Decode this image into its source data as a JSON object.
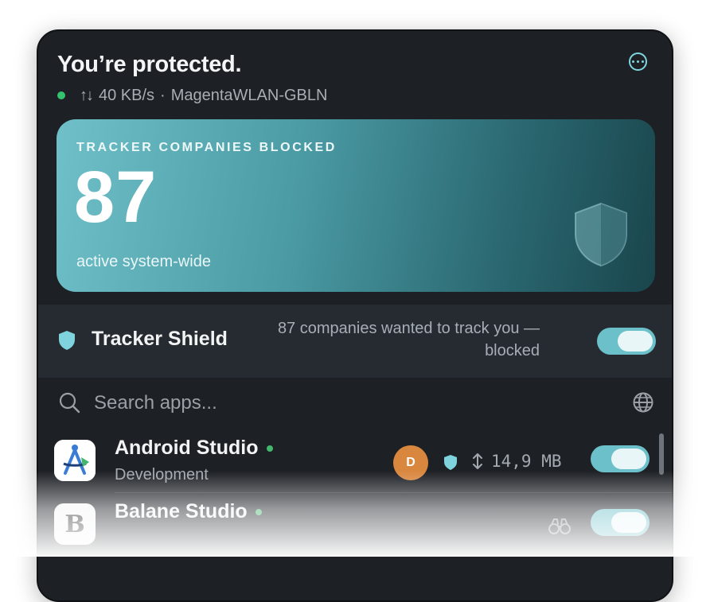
{
  "header": {
    "title": "You’re protected.",
    "status_arrows": "↑↓",
    "speed": "40 KB/s",
    "separator": "·",
    "network": "MagentaWLAN-GBLN",
    "more_icon": "ellipsis-circle-icon"
  },
  "hero": {
    "label": "TRACKER COMPANIES BLOCKED",
    "count": "87",
    "subtitle": "active system-wide",
    "icon": "shield-icon"
  },
  "tracker_shield": {
    "title": "Tracker Shield",
    "description": "87 companies wanted to track you — blocked",
    "toggle_on": true
  },
  "search": {
    "placeholder": "Search apps...",
    "value": "",
    "search_icon": "magnifier-icon",
    "globe_icon": "globe-icon"
  },
  "apps": [
    {
      "name": "Android Studio",
      "category": "Development",
      "avatar_letter": "D",
      "traffic_icon": "up-down-arrows-icon",
      "traffic": "14,9 MB",
      "online": true,
      "enabled": true
    },
    {
      "name": "Balane Studio",
      "icon_letter": "B",
      "activity_icon": "binoculars-icon",
      "online": true,
      "enabled": true
    }
  ],
  "colors": {
    "accent": "#6cc0c9",
    "online": "#34c26f",
    "avatar": "#d9873f",
    "background": "#1d2025"
  }
}
